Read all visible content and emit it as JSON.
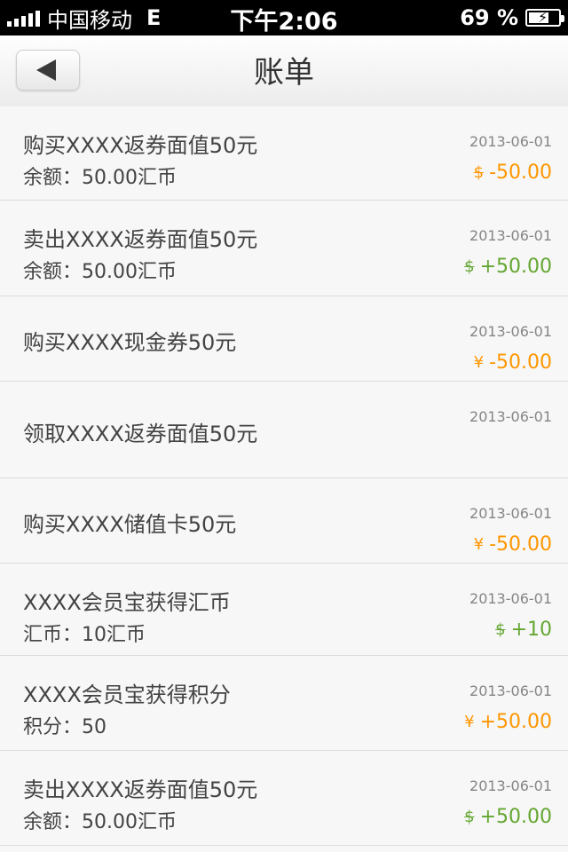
{
  "status_bar": {
    "carrier": "中国移动",
    "network": "E",
    "time": "下午2:06",
    "battery": "69 %",
    "battery_level": 0.69
  },
  "nav": {
    "title": "账单",
    "back_icon": "back-arrow-icon"
  },
  "colors": {
    "orange": "#FF9600",
    "green": "#63A631",
    "date_gray": "#858585",
    "text": "#434343"
  },
  "items": [
    {
      "title": "购买XXXX返券面值50元",
      "subtitle": "余额：50.00汇币",
      "date": "2013-06-01",
      "currency": "$",
      "amount": "-50.00",
      "color": "orange"
    },
    {
      "title": "卖出XXXX返券面值50元",
      "subtitle": "余额：50.00汇币",
      "date": "2013-06-01",
      "currency": "$",
      "amount": "+50.00",
      "color": "green"
    },
    {
      "title": "购买XXXX现金券50元",
      "subtitle": "",
      "date": "2013-06-01",
      "currency": "¥",
      "amount": "-50.00",
      "color": "orange"
    },
    {
      "title": "领取XXXX返券面值50元",
      "subtitle": "",
      "date": "2013-06-01",
      "currency": "",
      "amount": "",
      "color": "orange"
    },
    {
      "title": "购买XXXX储值卡50元",
      "subtitle": "",
      "date": "2013-06-01",
      "currency": "¥",
      "amount": "-50.00",
      "color": "orange"
    },
    {
      "title": "XXXX会员宝获得汇币",
      "subtitle": "汇币：10汇币",
      "date": "2013-06-01",
      "currency": "$",
      "amount": "+10",
      "color": "green"
    },
    {
      "title": "XXXX会员宝获得积分",
      "subtitle": "积分：50",
      "date": "2013-06-01",
      "currency": "¥",
      "amount": "+50.00",
      "color": "orange"
    },
    {
      "title": "卖出XXXX返券面值50元",
      "subtitle": "余额：50.00汇币",
      "date": "2013-06-01",
      "currency": "$",
      "amount": "+50.00",
      "color": "green"
    }
  ]
}
